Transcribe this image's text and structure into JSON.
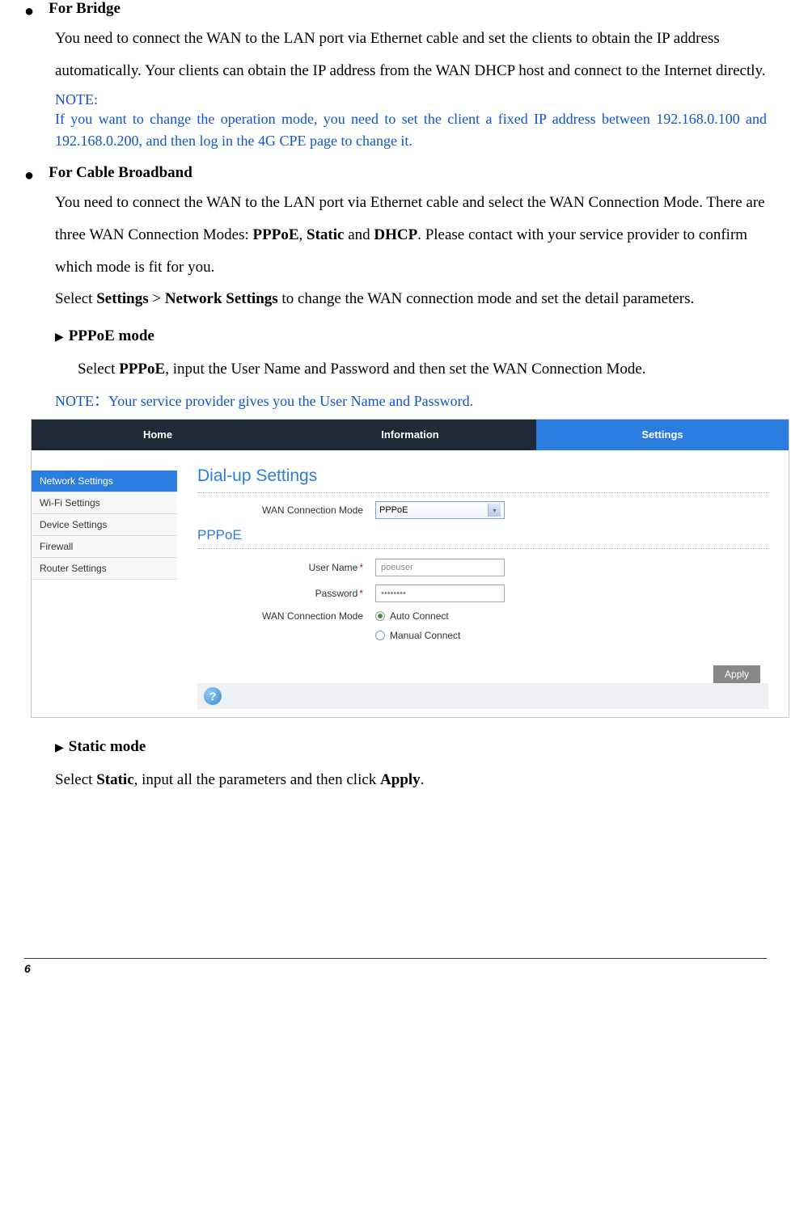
{
  "sections": {
    "bridge": {
      "title": "For Bridge",
      "body": "You need to connect the WAN to the LAN port via Ethernet cable and set the clients to obtain the IP address automatically. Your clients can obtain the IP address from the WAN DHCP host and connect to the Internet directly.",
      "note_label": "NOTE:",
      "note_text": "If you want to change the operation mode, you need to set the client a fixed IP address between 192.168.0.100 and 192.168.0.200, and then log in the 4G CPE page to change it."
    },
    "cable": {
      "title": "For Cable Broadband",
      "body_parts": {
        "p1a": "You need to connect the WAN to the LAN port via Ethernet cable and select the WAN Connection Mode. There are three WAN Connection Modes: ",
        "pppoe": "PPPoE",
        "comma1": ", ",
        "static": "Static",
        "and": " and ",
        "dhcp": "DHCP",
        "p1b": ". Please contact with your service provider to confirm which mode is fit for you.",
        "p2a": "Select ",
        "settings": "Settings",
        "gt": " > ",
        "network_settings": "Network Settings",
        "p2b": " to change the WAN connection mode and set the detail parameters."
      },
      "pppoe_mode": {
        "title": "PPPoE mode",
        "body_a": "Select ",
        "body_bold": "PPPoE",
        "body_b": ", input the User Name and Password and then set the WAN Connection Mode.",
        "note_label": "NOTE：",
        "note_text": "Your service provider gives you the User Name and Password."
      },
      "static_mode": {
        "title": "Static mode",
        "body_a": "Select ",
        "body_bold1": "Static",
        "body_mid": ", input all the parameters and then click ",
        "body_bold2": "Apply",
        "body_end": "."
      }
    }
  },
  "ui": {
    "tabs": {
      "home": "Home",
      "information": "Information",
      "settings": "Settings"
    },
    "sidebar": {
      "network": "Network Settings",
      "wifi": "Wi-Fi Settings",
      "device": "Device Settings",
      "firewall": "Firewall",
      "router": "Router Settings"
    },
    "panel": {
      "title": "Dial-up Settings",
      "wan_mode_label": "WAN Connection Mode",
      "wan_mode_value": "PPPoE",
      "pppoe_header": "PPPoE",
      "username_label": "User Name",
      "username_value": "poeuser",
      "password_label": "Password",
      "password_value": "••••••••",
      "wan_conn_mode_label": "WAN Connection Mode",
      "auto_connect": "Auto Connect",
      "manual_connect": "Manual Connect",
      "apply": "Apply",
      "help": "?"
    }
  },
  "footer": {
    "page": "6"
  }
}
